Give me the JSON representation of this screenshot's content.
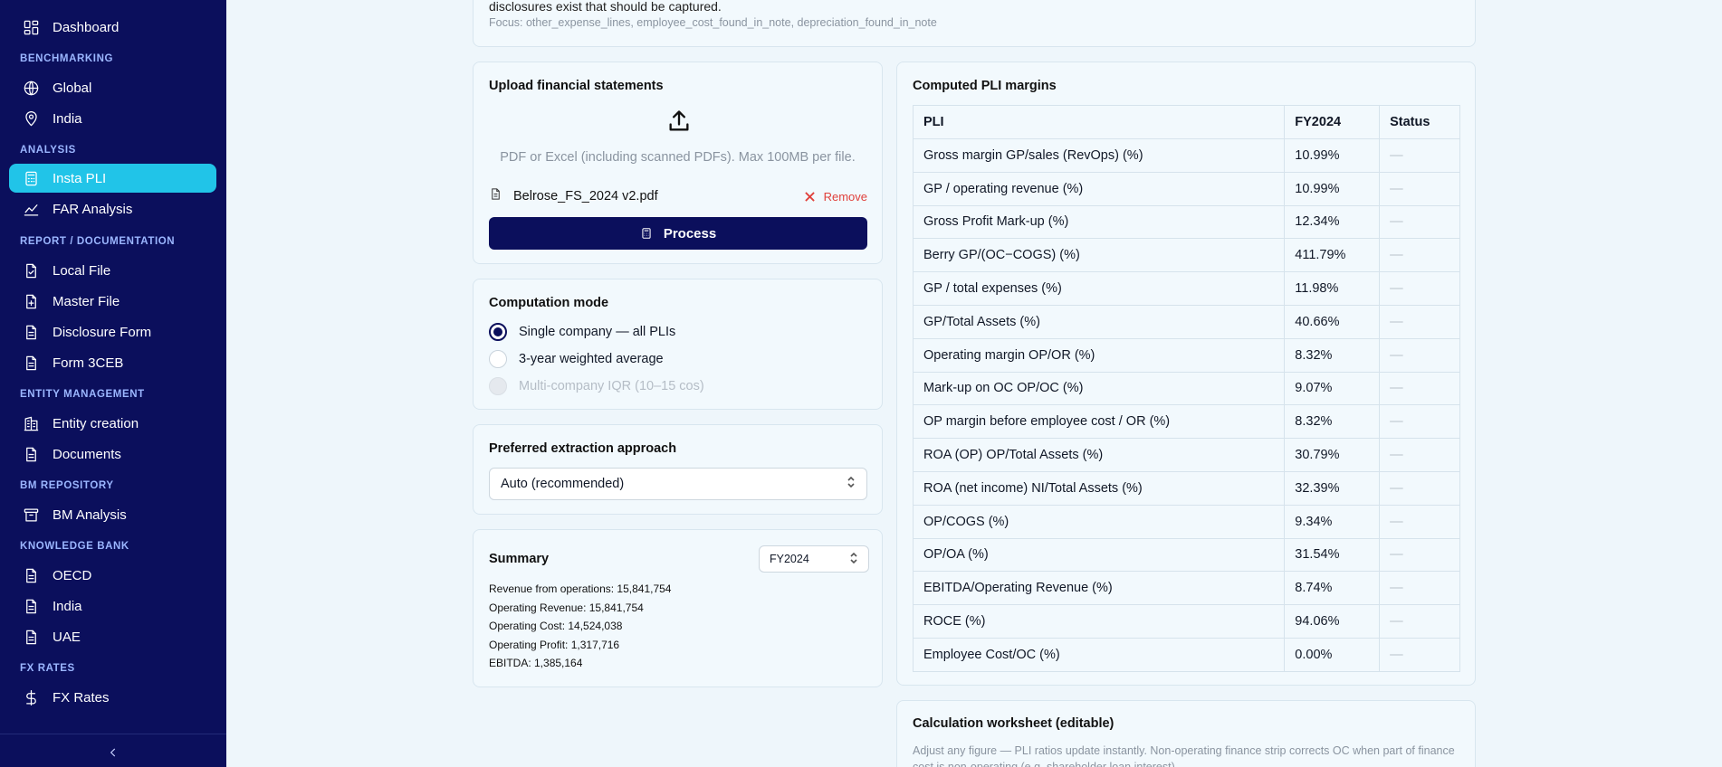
{
  "sidebar": {
    "dashboard": "Dashboard",
    "sections": {
      "benchmarking": "BENCHMARKING",
      "analysis": "ANALYSIS",
      "report": "REPORT / DOCUMENTATION",
      "entity": "ENTITY MANAGEMENT",
      "bm_repo": "BM REPOSITORY",
      "knowledge": "KNOWLEDGE BANK",
      "fx": "FX RATES"
    },
    "items": {
      "global": "Global",
      "india": "India",
      "insta_pli": "Insta PLI",
      "far_analysis": "FAR Analysis",
      "local_file": "Local File",
      "master_file": "Master File",
      "disclosure_form": "Disclosure Form",
      "form_3ceb": "Form 3CEB",
      "entity_creation": "Entity creation",
      "documents": "Documents",
      "bm_analysis": "BM Analysis",
      "oecd": "OECD",
      "kb_india": "India",
      "uae": "UAE",
      "fx_rates": "FX Rates"
    },
    "active_item": "Insta PLI"
  },
  "top_card": {
    "text": "disclosures exist that should be captured.",
    "focus": "Focus: other_expense_lines, employee_cost_found_in_note, depreciation_found_in_note"
  },
  "upload": {
    "title": "Upload financial statements",
    "hint": "PDF or Excel (including scanned PDFs). Max 100MB per file.",
    "file_name": "Belrose_FS_2024 v2.pdf",
    "remove_label": "Remove",
    "process_label": "Process"
  },
  "mode": {
    "title": "Computation mode",
    "options": [
      {
        "label": "Single company — all PLIs",
        "selected": true,
        "disabled": false
      },
      {
        "label": "3-year weighted average",
        "selected": false,
        "disabled": false
      },
      {
        "label": "Multi-company IQR (10–15 cos)",
        "selected": false,
        "disabled": true
      }
    ]
  },
  "extraction": {
    "title": "Preferred extraction approach",
    "value": "Auto (recommended)"
  },
  "summary": {
    "title": "Summary",
    "year": "FY2024",
    "lines": [
      "Revenue from operations: 15,841,754",
      "Operating Revenue: 15,841,754",
      "Operating Cost: 14,524,038",
      "Operating Profit: 1,317,716",
      "EBITDA: 1,385,164"
    ]
  },
  "pli": {
    "title": "Computed PLI margins",
    "headers": [
      "PLI",
      "FY2024",
      "Status"
    ],
    "rows": [
      [
        "Gross margin GP/sales (RevOps) (%)",
        "10.99%",
        "—"
      ],
      [
        "GP / operating revenue (%)",
        "10.99%",
        "—"
      ],
      [
        "Gross Profit Mark-up (%)",
        "12.34%",
        "—"
      ],
      [
        "Berry GP/(OC−COGS) (%)",
        "411.79%",
        "—"
      ],
      [
        "GP / total expenses (%)",
        "11.98%",
        "—"
      ],
      [
        "GP/Total Assets (%)",
        "40.66%",
        "—"
      ],
      [
        "Operating margin OP/OR (%)",
        "8.32%",
        "—"
      ],
      [
        "Mark-up on OC OP/OC (%)",
        "9.07%",
        "—"
      ],
      [
        "OP margin before employee cost / OR (%)",
        "8.32%",
        "—"
      ],
      [
        "ROA (OP) OP/Total Assets (%)",
        "30.79%",
        "—"
      ],
      [
        "ROA (net income) NI/Total Assets (%)",
        "32.39%",
        "—"
      ],
      [
        "OP/COGS (%)",
        "9.34%",
        "—"
      ],
      [
        "OP/OA (%)",
        "31.54%",
        "—"
      ],
      [
        "EBITDA/Operating Revenue (%)",
        "8.74%",
        "—"
      ],
      [
        "ROCE (%)",
        "94.06%",
        "—"
      ],
      [
        "Employee Cost/OC (%)",
        "0.00%",
        "—"
      ]
    ]
  },
  "worksheet": {
    "title": "Calculation worksheet (editable)",
    "desc": "Adjust any figure — PLI ratios update instantly. Non-operating finance strip corrects OC when part of finance cost is non-operating (e.g. shareholder loan interest)."
  }
}
